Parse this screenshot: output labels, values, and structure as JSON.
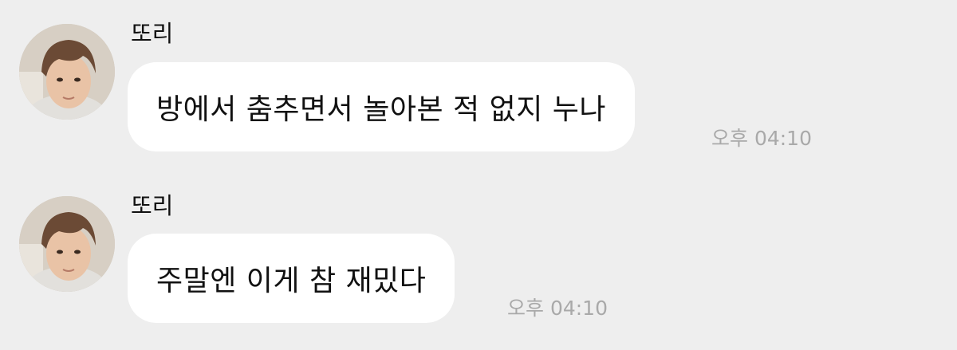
{
  "colors": {
    "background": "#eeeeee",
    "bubble": "#ffffff",
    "text": "#111111",
    "timestamp": "#a9a9a9"
  },
  "messages": [
    {
      "sender": "또리",
      "avatar_icon": "profile-photo",
      "text": "방에서 춤추면서 놀아본 적 없지 누나",
      "time": "오후 04:10"
    },
    {
      "sender": "또리",
      "avatar_icon": "profile-photo",
      "text": "주말엔 이게 참 재밌다",
      "time": "오후 04:10"
    }
  ]
}
